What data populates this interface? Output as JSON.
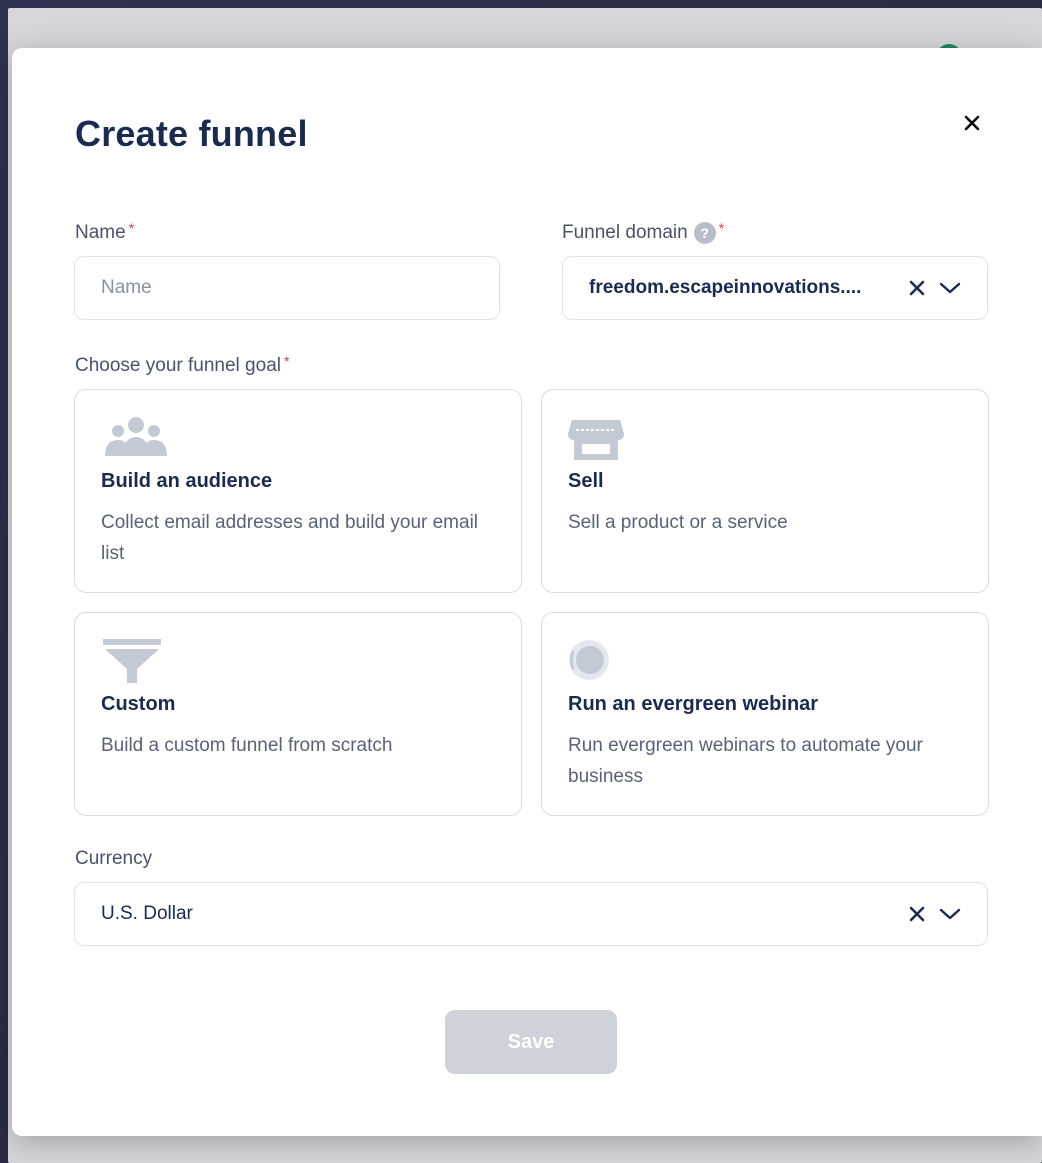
{
  "modal": {
    "title": "Create funnel",
    "close_icon": "close-icon"
  },
  "name_field": {
    "label": "Name",
    "required_mark": "*",
    "placeholder": "Name",
    "value": ""
  },
  "domain_field": {
    "label": "Funnel domain",
    "help_icon": "?",
    "required_mark": "*",
    "value": "freedom.escapeinnovations...."
  },
  "goal": {
    "label": "Choose your funnel goal",
    "required_mark": "*",
    "options": [
      {
        "icon": "audience-icon",
        "title": "Build an audience",
        "description": "Collect email addresses and build your email list"
      },
      {
        "icon": "store-icon",
        "title": "Sell",
        "description": "Sell a product or a service"
      },
      {
        "icon": "funnel-icon",
        "title": "Custom",
        "description": "Build a custom funnel from scratch"
      },
      {
        "icon": "webinar-icon",
        "title": "Run an evergreen webinar",
        "description": "Run evergreen webinars to automate your business"
      }
    ]
  },
  "currency_field": {
    "label": "Currency",
    "value": "U.S. Dollar"
  },
  "actions": {
    "save_label": "Save"
  },
  "colors": {
    "title": "#1b2b4e",
    "required": "#e0344a",
    "save_disabled": "#ced3da",
    "icon_muted": "#c3cad4"
  }
}
